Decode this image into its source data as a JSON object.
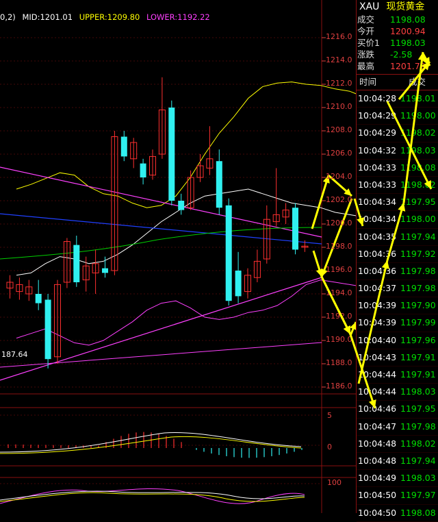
{
  "indicator": {
    "prefix": "0,2)",
    "mid_label": "MID:1201.01",
    "upper_label": "UPPER:1209.80",
    "lower_label": "LOWER:1192.22",
    "colors": {
      "mid": "#ffffff",
      "upper": "#ffff00",
      "lower": "#ff40ff"
    }
  },
  "price_axis": [
    "1216.0",
    "1214.0",
    "1212.0",
    "1210.0",
    "1208.0",
    "1206.0",
    "1204.0",
    "1202.0",
    "1200.0",
    "1198.0",
    "1196.0",
    "1194.0",
    "1192.0",
    "1190.0",
    "1188.0",
    "1186.0"
  ],
  "low_marker": "187.64",
  "sub1_axis": [
    "5",
    "0"
  ],
  "sub2_axis": [
    "100"
  ],
  "quote": {
    "symbol": "XAU",
    "name": "现货黄金",
    "rows": [
      {
        "label": "成交",
        "value": "1198.08",
        "color": "#00e000"
      },
      {
        "label": "今开",
        "value": "1200.94",
        "color": "#ff4040"
      },
      {
        "label": "买价1",
        "value": "1198.03",
        "color": "#00e000"
      },
      {
        "label": "涨跌",
        "value": "-2.58",
        "color": "#00e000"
      },
      {
        "label": "最高",
        "value": "1201.79",
        "color": "#ff4040"
      }
    ]
  },
  "trades_header": {
    "time": "时间",
    "price": "成交"
  },
  "trades": [
    {
      "time": "10:04:28",
      "price": "1198.01"
    },
    {
      "time": "10:04:29",
      "price": "1198.00"
    },
    {
      "time": "10:04:29",
      "price": "1198.02"
    },
    {
      "time": "10:04:32",
      "price": "1198.03"
    },
    {
      "time": "10:04:33",
      "price": "1198.08"
    },
    {
      "time": "10:04:33",
      "price": "1198.02"
    },
    {
      "time": "10:04:34",
      "price": "1197.95"
    },
    {
      "time": "10:04:34",
      "price": "1198.00"
    },
    {
      "time": "10:04:35",
      "price": "1197.94"
    },
    {
      "time": "10:04:36",
      "price": "1197.92"
    },
    {
      "time": "10:04:36",
      "price": "1197.98"
    },
    {
      "time": "10:04:37",
      "price": "1197.98"
    },
    {
      "time": "10:04:39",
      "price": "1197.90"
    },
    {
      "time": "10:04:39",
      "price": "1197.99"
    },
    {
      "time": "10:04:40",
      "price": "1197.96"
    },
    {
      "time": "10:04:43",
      "price": "1197.91"
    },
    {
      "time": "10:04:44",
      "price": "1197.91"
    },
    {
      "time": "10:04:44",
      "price": "1198.03"
    },
    {
      "time": "10:04:46",
      "price": "1197.95"
    },
    {
      "time": "10:04:47",
      "price": "1197.98"
    },
    {
      "time": "10:04:48",
      "price": "1198.02"
    },
    {
      "time": "10:04:48",
      "price": "1197.94"
    },
    {
      "time": "10:04:49",
      "price": "1198.03"
    },
    {
      "time": "10:04:50",
      "price": "1197.97"
    },
    {
      "time": "10:04:50",
      "price": "1198.08"
    }
  ],
  "candles": [
    {
      "o": 1194.5,
      "c": 1195.0,
      "h": 1195.6,
      "l": 1193.6
    },
    {
      "o": 1194.2,
      "c": 1194.8,
      "h": 1195.4,
      "l": 1193.5
    },
    {
      "o": 1194.0,
      "c": 1194.6,
      "h": 1195.2,
      "l": 1193.4
    },
    {
      "o": 1194.0,
      "c": 1193.2,
      "h": 1195.2,
      "l": 1192.6
    },
    {
      "o": 1193.5,
      "c": 1188.4,
      "h": 1194.0,
      "l": 1187.6
    },
    {
      "o": 1188.6,
      "c": 1194.8,
      "h": 1195.2,
      "l": 1188.0
    },
    {
      "o": 1195.0,
      "c": 1198.5,
      "h": 1198.8,
      "l": 1194.5
    },
    {
      "o": 1198.2,
      "c": 1195.0,
      "h": 1199.0,
      "l": 1194.6
    },
    {
      "o": 1195.2,
      "c": 1196.4,
      "h": 1197.2,
      "l": 1194.2
    },
    {
      "o": 1195.8,
      "c": 1196.6,
      "h": 1197.8,
      "l": 1194.0
    },
    {
      "o": 1196.2,
      "c": 1195.8,
      "h": 1197.2,
      "l": 1195.4
    },
    {
      "o": 1196.0,
      "c": 1207.5,
      "h": 1208.0,
      "l": 1195.6
    },
    {
      "o": 1207.5,
      "c": 1205.8,
      "h": 1208.0,
      "l": 1205.4
    },
    {
      "o": 1205.6,
      "c": 1207.0,
      "h": 1207.4,
      "l": 1204.8
    },
    {
      "o": 1205.2,
      "c": 1204.0,
      "h": 1205.6,
      "l": 1203.4
    },
    {
      "o": 1204.2,
      "c": 1205.8,
      "h": 1206.4,
      "l": 1203.8
    },
    {
      "o": 1206.0,
      "c": 1209.8,
      "h": 1212.6,
      "l": 1205.6
    },
    {
      "o": 1210.0,
      "c": 1202.0,
      "h": 1210.6,
      "l": 1201.6
    },
    {
      "o": 1202.0,
      "c": 1201.2,
      "h": 1202.6,
      "l": 1200.8
    },
    {
      "o": 1201.4,
      "c": 1204.0,
      "h": 1204.6,
      "l": 1201.2
    },
    {
      "o": 1204.0,
      "c": 1205.0,
      "h": 1206.0,
      "l": 1203.6
    },
    {
      "o": 1204.8,
      "c": 1205.6,
      "h": 1208.4,
      "l": 1204.2
    },
    {
      "o": 1205.4,
      "c": 1201.4,
      "h": 1206.4,
      "l": 1200.8
    },
    {
      "o": 1201.6,
      "c": 1193.4,
      "h": 1202.2,
      "l": 1193.0
    },
    {
      "o": 1196.0,
      "c": 1193.8,
      "h": 1197.6,
      "l": 1193.2
    },
    {
      "o": 1194.2,
      "c": 1195.6,
      "h": 1196.2,
      "l": 1193.6
    },
    {
      "o": 1195.4,
      "c": 1196.8,
      "h": 1197.8,
      "l": 1195.0
    },
    {
      "o": 1197.0,
      "c": 1200.4,
      "h": 1201.6,
      "l": 1196.6
    },
    {
      "o": 1200.2,
      "c": 1200.8,
      "h": 1204.8,
      "l": 1199.8
    },
    {
      "o": 1200.6,
      "c": 1201.2,
      "h": 1201.8,
      "l": 1200.0
    },
    {
      "o": 1201.4,
      "c": 1197.8,
      "h": 1201.8,
      "l": 1197.4
    },
    {
      "o": 1198.0,
      "c": 1198.1,
      "h": 1198.6,
      "l": 1197.6
    }
  ],
  "overlay_lines": {
    "upper": [
      1203,
      1203.4,
      1203.9,
      1204.4,
      1204.2,
      1203.2,
      1202.6,
      1202.4,
      1201.8,
      1201.4,
      1201.6,
      1202.4,
      1204.0,
      1206.0,
      1207.8,
      1209.2,
      1210.8,
      1211.8,
      1212.1,
      1212.2,
      1212.0,
      1211.9,
      1211.6,
      1211.4,
      1210.9,
      1210.4,
      1210.0
    ],
    "mid": [
      1195.6,
      1195.8,
      1196.6,
      1197.2,
      1197.0,
      1196.6,
      1196.8,
      1197.4,
      1198.2,
      1199.2,
      1200.2,
      1201.0,
      1201.8,
      1202.4,
      1202.6,
      1202.8,
      1203.0,
      1202.6,
      1202.2,
      1201.8,
      1201.6,
      1201.4,
      1201.0,
      1200.8,
      1200.6,
      1200.4,
      1200.2
    ],
    "lower": [
      1190.2,
      1190.6,
      1191.0,
      1190.4,
      1189.8,
      1189.6,
      1190.0,
      1190.8,
      1191.6,
      1192.6,
      1193.2,
      1193.4,
      1192.8,
      1192.0,
      1191.8,
      1192.0,
      1192.4,
      1192.6,
      1193.0,
      1193.8,
      1194.8,
      1195.2,
      1195.0,
      1194.8,
      1194.6,
      1194.0,
      1193.8
    ]
  }
}
